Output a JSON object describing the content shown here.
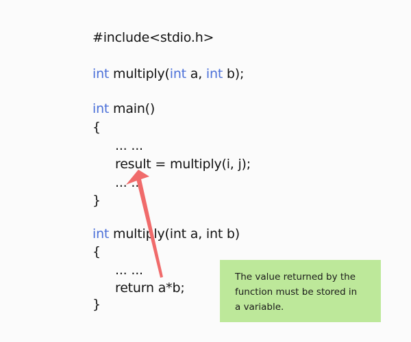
{
  "code": {
    "include": "#include<stdio.h>",
    "proto_kw1": "int",
    "proto_mid": " multiply(",
    "proto_kw2": "int",
    "proto_a": " a, ",
    "proto_kw3": "int",
    "proto_end": " b);",
    "main_kw": "int",
    "main_rest": " main()",
    "brace_open_1": "{",
    "dots_1": "... ...",
    "result_line": "result = multiply(i, j);",
    "dots_2": "... ...",
    "brace_close_1": "}",
    "def_kw": "int",
    "def_rest": " multiply(int a, int b)",
    "brace_open_2": "{",
    "dots_3": "... ...",
    "return_line": "return a*b;",
    "brace_close_2": "}"
  },
  "note": {
    "line1": "The value returned by the",
    "line2": "function must be stored in",
    "line3": "a variable."
  },
  "colors": {
    "keyword": "#4a6fd8",
    "note_bg": "#bde89a",
    "arrow": "#f06b6b"
  }
}
